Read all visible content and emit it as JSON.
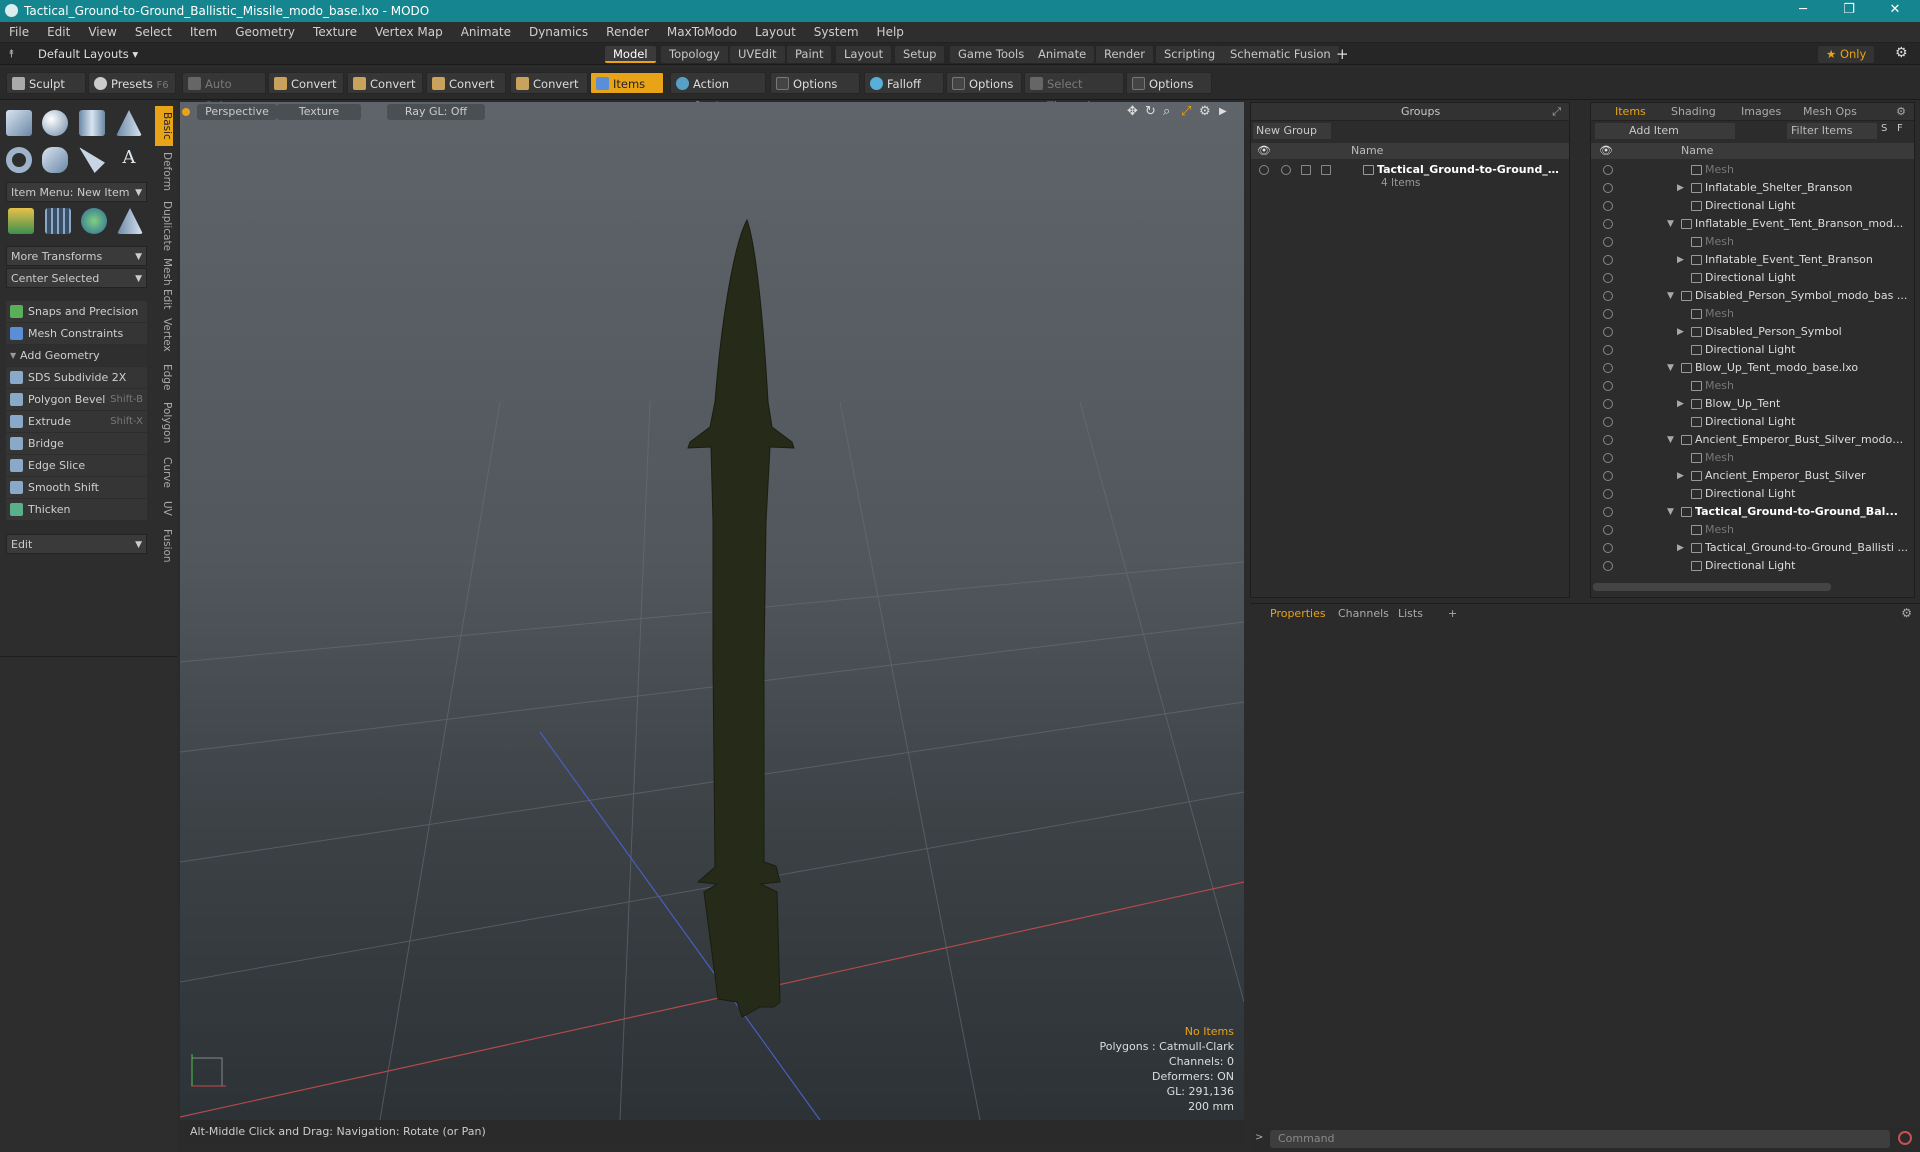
{
  "window": {
    "title": "Tactical_Ground-to-Ground_Ballistic_Missile_modo_base.lxo - MODO",
    "minimize": "─",
    "maximize": "❐",
    "close": "✕"
  },
  "menu": [
    "File",
    "Edit",
    "View",
    "Select",
    "Item",
    "Geometry",
    "Texture",
    "Vertex Map",
    "Animate",
    "Dynamics",
    "Render",
    "MaxToModo",
    "Layout",
    "System",
    "Help"
  ],
  "layout_bar": {
    "default_layouts": "Default Layouts ▾",
    "tabs": [
      "Model",
      "Topology",
      "UVEdit",
      "Paint",
      "Layout",
      "Setup",
      "Game Tools",
      "Animate",
      "Render",
      "Scripting",
      "Schematic Fusion"
    ],
    "active_tab": "Model",
    "add": "+",
    "only": "★  Only"
  },
  "toolbar": {
    "sculpt": "Sculpt",
    "presets": "Presets",
    "presets_key": "F6",
    "auto_select": "Auto Select",
    "convert1": "Convert",
    "convert2": "Convert",
    "convert3": "Convert",
    "convert4": "Convert",
    "items": "Items",
    "action_center": "Action Center",
    "options1": "Options",
    "falloff": "Falloff",
    "options2": "Options",
    "select_through": "Select Through",
    "options3": "Options"
  },
  "left_panel": {
    "item_menu": "Item Menu: New Item",
    "more_transforms": "More Transforms",
    "center_selected": "Center Selected",
    "snaps": "Snaps and Precision",
    "mesh_constraints": "Mesh Constraints",
    "add_geometry": "Add Geometry",
    "tools": [
      {
        "label": "SDS Subdivide 2X",
        "key": ""
      },
      {
        "label": "Polygon Bevel",
        "key": "Shift-B"
      },
      {
        "label": "Extrude",
        "key": "Shift-X"
      },
      {
        "label": "Bridge",
        "key": ""
      },
      {
        "label": "Edge Slice",
        "key": ""
      },
      {
        "label": "Smooth Shift",
        "key": ""
      },
      {
        "label": "Thicken",
        "key": ""
      }
    ],
    "edit": "Edit",
    "vtabs": [
      "Basic",
      "Deform",
      "Duplicate",
      "Mesh Edit",
      "Vertex",
      "Edge",
      "Polygon",
      "Curve",
      "UV",
      "Fusion"
    ]
  },
  "viewport": {
    "perspective": "Perspective",
    "texture": "Texture",
    "raygl": "Ray GL: Off",
    "info": {
      "no_items": "No Items",
      "polygons": "Polygons : Catmull-Clark",
      "channels": "Channels: 0",
      "deformers": "Deformers: ON",
      "gl": "GL: 291,136",
      "scale": "200 mm"
    }
  },
  "status": "Alt-Middle Click and Drag:   Navigation: Rotate (or Pan)",
  "groups_panel": {
    "title": "Groups",
    "new_group": "New Group",
    "name_col": "Name",
    "group_name": "Tactical_Ground-to-Ground_Bal...",
    "group_count": "4 Items"
  },
  "items_panel": {
    "tabs": [
      "Items",
      "Shading",
      "Images",
      "Mesh Ops"
    ],
    "add_item": "Add Item",
    "filter": "Filter Items",
    "s": "S",
    "f": "F",
    "name_col": "Name",
    "rows": [
      {
        "label": "Mesh",
        "kind": "mesh",
        "indent": 2
      },
      {
        "label": "Inflatable_Shelter_Branson",
        "kind": "item",
        "indent": 2
      },
      {
        "label": "Directional Light",
        "kind": "light",
        "indent": 2
      },
      {
        "label": "Inflatable_Event_Tent_Branson_mod...",
        "kind": "scene",
        "indent": 1
      },
      {
        "label": "Mesh",
        "kind": "mesh",
        "indent": 2
      },
      {
        "label": "Inflatable_Event_Tent_Branson",
        "kind": "item",
        "indent": 2
      },
      {
        "label": "Directional Light",
        "kind": "light",
        "indent": 2
      },
      {
        "label": "Disabled_Person_Symbol_modo_bas ...",
        "kind": "scene",
        "indent": 1
      },
      {
        "label": "Mesh",
        "kind": "mesh",
        "indent": 2
      },
      {
        "label": "Disabled_Person_Symbol",
        "kind": "item",
        "indent": 2
      },
      {
        "label": "Directional Light",
        "kind": "light",
        "indent": 2
      },
      {
        "label": "Blow_Up_Tent_modo_base.lxo",
        "kind": "scene",
        "indent": 1
      },
      {
        "label": "Mesh",
        "kind": "mesh",
        "indent": 2
      },
      {
        "label": "Blow_Up_Tent",
        "kind": "item",
        "indent": 2
      },
      {
        "label": "Directional Light",
        "kind": "light",
        "indent": 2
      },
      {
        "label": "Ancient_Emperor_Bust_Silver_modo_...",
        "kind": "scene",
        "indent": 1
      },
      {
        "label": "Mesh",
        "kind": "mesh",
        "indent": 2
      },
      {
        "label": "Ancient_Emperor_Bust_Silver",
        "kind": "item",
        "indent": 2
      },
      {
        "label": "Directional Light",
        "kind": "light",
        "indent": 2
      },
      {
        "label": "Tactical_Ground-to-Ground_Bal...",
        "kind": "scene-bold",
        "indent": 1
      },
      {
        "label": "Mesh",
        "kind": "mesh",
        "indent": 2
      },
      {
        "label": "Tactical_Ground-to-Ground_Ballisti ...",
        "kind": "item",
        "indent": 2
      },
      {
        "label": "Directional Light",
        "kind": "light",
        "indent": 2
      }
    ]
  },
  "props_panel": {
    "tabs": [
      "Properties",
      "Channels",
      "Lists"
    ],
    "add": "+"
  },
  "command": {
    "placeholder": "Command"
  },
  "colors": {
    "accent": "#e8a317",
    "title_bar": "#15868f",
    "missile": "#262a18"
  }
}
